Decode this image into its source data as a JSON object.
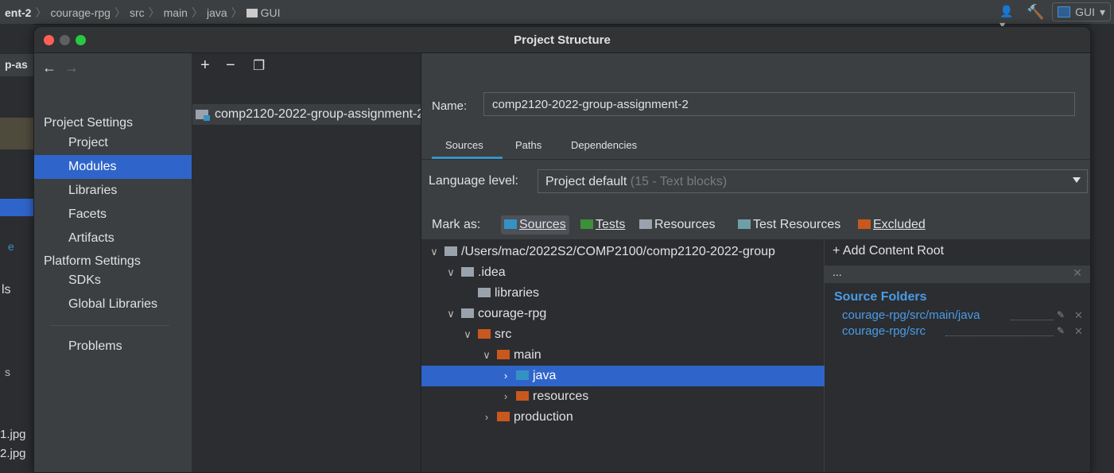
{
  "ide": {
    "breadcrumbs": [
      "ent-2",
      "courage-rpg",
      "src",
      "main",
      "java",
      "GUI"
    ],
    "run_config": "GUI",
    "left_fragments": [
      "p-as",
      "e",
      "ls",
      "s",
      "1.jpg",
      "2.jpg"
    ]
  },
  "dialog": {
    "title": "Project Structure",
    "nav": {
      "back": "←",
      "forward": "→",
      "project_settings_header": "Project Settings",
      "project_items": [
        "Project",
        "Modules",
        "Libraries",
        "Facets",
        "Artifacts"
      ],
      "platform_settings_header": "Platform Settings",
      "platform_items": [
        "SDKs",
        "Global Libraries"
      ],
      "problems": "Problems",
      "selected": "Modules"
    },
    "middle": {
      "add": "+",
      "remove": "−",
      "copy": "❐",
      "module_name": "comp2120-2022-group-assignment-2"
    },
    "right": {
      "name_label": "Name:",
      "name_value": "comp2120-2022-group-assignment-2",
      "tabs": [
        "Sources",
        "Paths",
        "Dependencies"
      ],
      "language_label": "Language level:",
      "language_value": "Project default",
      "language_detail": "(15 - Text blocks)",
      "mark_as_label": "Mark as:",
      "mark_sources": "Sources",
      "mark_tests": "Tests",
      "mark_resources": "Resources",
      "mark_test_resources": "Test Resources",
      "mark_excluded": "Excluded",
      "tree": {
        "root": "/Users/mac/2022S2/COMP2100/comp2120-2022-group",
        "idea": ".idea",
        "libraries": "libraries",
        "courage": "courage-rpg",
        "src": "src",
        "main": "main",
        "java": "java",
        "resources": "resources",
        "production": "production"
      },
      "add_content_root": "Add Content Root",
      "panel_dots": "...",
      "source_folders_title": "Source Folders",
      "source_folders": [
        "courage-rpg/src/main/java",
        "courage-rpg/src"
      ]
    }
  },
  "colors": {
    "accent": "#2f65ca",
    "sources_blue": "#3592c4",
    "tests_green": "#3d8f3a",
    "excluded_orange": "#c8581e",
    "link_blue": "#4a9ce8"
  }
}
